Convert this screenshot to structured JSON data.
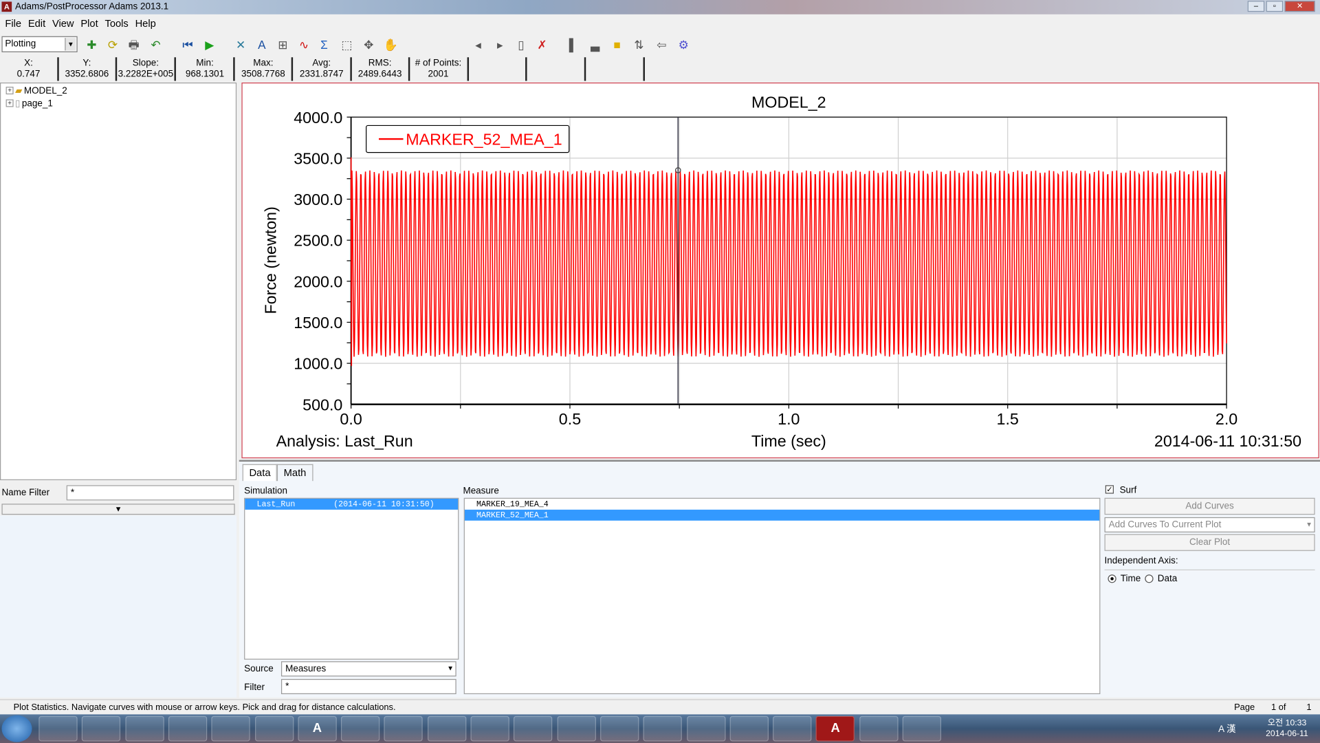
{
  "window": {
    "title": "Adams/PostProcessor Adams 2013.1",
    "app_icon_letter": "A"
  },
  "menu": [
    "File",
    "Edit",
    "View",
    "Plot",
    "Tools",
    "Help"
  ],
  "toolbar": {
    "mode": "Plotting",
    "icons": [
      "add-page-icon",
      "refresh-icon",
      "print-icon",
      "undo-icon",
      "rewind-icon",
      "play-icon",
      "axes-tool-icon",
      "text-icon",
      "grid-icon",
      "curve-edit-icon",
      "sum-icon",
      "zoom-box-icon",
      "fit-icon",
      "pan-hand-icon",
      "previous-page-icon",
      "next-page-icon",
      "new-page-icon",
      "delete-page-icon",
      "layout-icon",
      "layout2-icon",
      "color-icon",
      "toggle-icon",
      "export-icon",
      "settings-gear-icon"
    ]
  },
  "stats": [
    {
      "label": "X:",
      "value": "0.747"
    },
    {
      "label": "Y:",
      "value": "3352.6806"
    },
    {
      "label": "Slope:",
      "value": "3.2282E+005"
    },
    {
      "label": "Min:",
      "value": "968.1301"
    },
    {
      "label": "Max:",
      "value": "3508.7768"
    },
    {
      "label": "Avg:",
      "value": "2331.8747"
    },
    {
      "label": "RMS:",
      "value": "2489.6443"
    },
    {
      "label": "# of Points:",
      "value": "2001"
    },
    {
      "label": "",
      "value": ""
    },
    {
      "label": "",
      "value": ""
    },
    {
      "label": "",
      "value": ""
    }
  ],
  "tree": [
    {
      "label": "MODEL_2"
    },
    {
      "label": "page_1"
    }
  ],
  "name_filter": {
    "label": "Name Filter",
    "value": "*"
  },
  "chart_data": {
    "type": "line",
    "title": "MODEL_2",
    "xlabel": "Time (sec)",
    "ylabel": "Force (newton)",
    "xlim": [
      0.0,
      2.0
    ],
    "ylim": [
      500.0,
      4000.0
    ],
    "xticks": [
      "0.0",
      "0.5",
      "1.0",
      "1.5",
      "2.0"
    ],
    "yticks": [
      "500.0",
      "1000.0",
      "1500.0",
      "2000.0",
      "2500.0",
      "3000.0",
      "3500.0",
      "4000.0"
    ],
    "grid": true,
    "legend_placement": "top-left",
    "series": [
      {
        "name": "MARKER_52_MEA_1",
        "color": "#ff0000",
        "points": 2001,
        "min": 968.1301,
        "max": 3508.7768,
        "avg": 2331.8747,
        "upper_envelope": 3350,
        "lower_envelope": 1080,
        "initial_value": 3508.7768
      }
    ],
    "cursor_x": 0.747,
    "footer_left": "Analysis:  Last_Run",
    "footer_right": "2014-06-11 10:31:50"
  },
  "bottom": {
    "tabs": [
      "Data",
      "Math"
    ],
    "simulation_label": "Simulation",
    "simulations": [
      {
        "name": "Last_Run",
        "time": "(2014-06-11 10:31:50)"
      }
    ],
    "measure_label": "Measure",
    "measures": [
      "MARKER_19_MEA_4",
      "MARKER_52_MEA_1"
    ],
    "surf_label": "Surf",
    "add_curves": "Add Curves",
    "add_mode": "Add Curves To Current Plot",
    "clear_plot": "Clear Plot",
    "indep_axis": "Independent Axis:",
    "time": "Time",
    "data": "Data",
    "source_label": "Source",
    "source_value": "Measures",
    "filter_label": "Filter",
    "filter_value": "*"
  },
  "status": {
    "message": "Plot Statistics.  Navigate curves with mouse or arrow keys.  Pick and drag for distance calculations.",
    "page_label": "Page",
    "page": "1 of",
    "page_total": "1"
  },
  "taskbar": {
    "apps": [
      "ie-icon",
      "explorer-icon",
      "media-icon",
      "app-icon",
      "app-icon",
      "app-icon",
      "adams-a-icon",
      "p-icon",
      "app-icon",
      "app-icon",
      "excel-icon",
      "app-icon",
      "app-icon",
      "app-icon",
      "chrome-icon",
      "kakaotalk-icon",
      "app-icon",
      "app-icon",
      "adams-postprocessor-icon",
      "app-icon",
      "app-icon"
    ],
    "tray": "A 漢",
    "clock_time": "오전 10:33",
    "clock_date": "2014-06-11"
  }
}
